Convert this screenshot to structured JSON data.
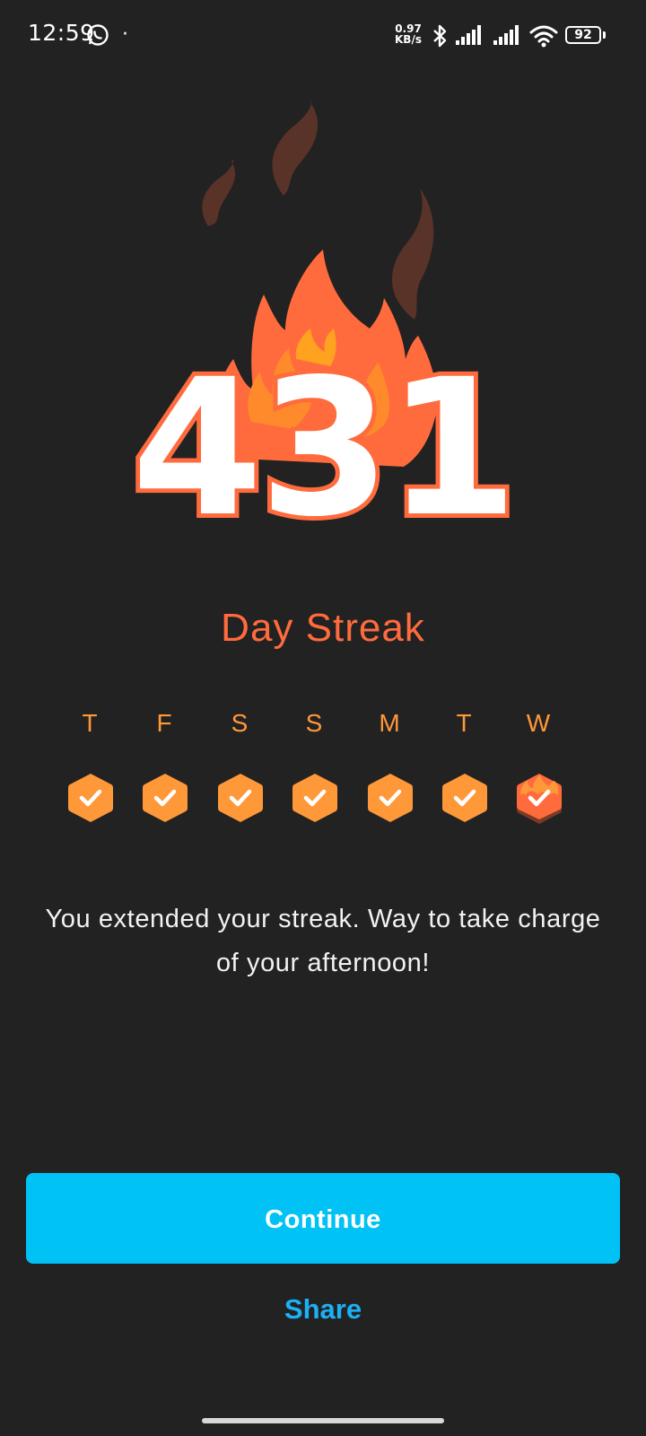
{
  "status_bar": {
    "time": "12:59",
    "notification_dot": "·",
    "net_speed_value": "0.97",
    "net_speed_unit": "KB/s",
    "battery": "92",
    "icons": [
      "whatsapp-icon",
      "bluetooth-icon",
      "signal-icon",
      "signal-icon",
      "wifi-icon",
      "battery-icon"
    ]
  },
  "streak": {
    "count": "431",
    "label": "Day Streak",
    "accent_color": "#ff6b3d",
    "day_color": "#ff9838"
  },
  "week": {
    "days": [
      {
        "label": "T",
        "state": "completed"
      },
      {
        "label": "F",
        "state": "completed"
      },
      {
        "label": "S",
        "state": "completed"
      },
      {
        "label": "S",
        "state": "completed"
      },
      {
        "label": "M",
        "state": "completed"
      },
      {
        "label": "T",
        "state": "completed"
      },
      {
        "label": "W",
        "state": "today"
      }
    ]
  },
  "message": "You extended your streak. Way to take charge of your afternoon!",
  "buttons": {
    "continue_label": "Continue",
    "continue_color": "#00c2f5",
    "share_label": "Share",
    "share_color": "#1cb0f6"
  }
}
